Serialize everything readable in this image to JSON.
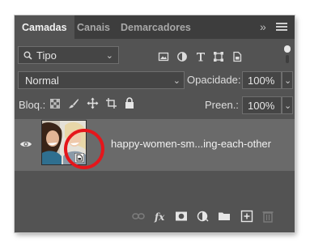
{
  "tabs": [
    "Camadas",
    "Canais",
    "Demarcadores"
  ],
  "tab_overflow": "»",
  "filter": {
    "label": "Tipo",
    "icons": [
      "image-filter-icon",
      "adjustment-filter-icon",
      "type-filter-icon",
      "shape-filter-icon",
      "smart-object-filter-icon"
    ]
  },
  "blend": {
    "mode": "Normal",
    "opacity_label": "Opacidade:",
    "opacity_value": "100%"
  },
  "lock": {
    "label": "Bloq.:",
    "fill_label": "Preen.:",
    "fill_value": "100%"
  },
  "layer": {
    "name": "happy-women-sm...ing-each-other",
    "type": "smart-object"
  },
  "colors": {
    "panel": "#535353",
    "tabbar": "#3d3d3d",
    "layer_selected": "#6a6a6a",
    "annotation": "#e5161b"
  },
  "bottom_icons": [
    "link-icon",
    "fx-icon",
    "mask-icon",
    "adjustment-icon",
    "folder-icon",
    "new-layer-icon",
    "trash-icon"
  ]
}
